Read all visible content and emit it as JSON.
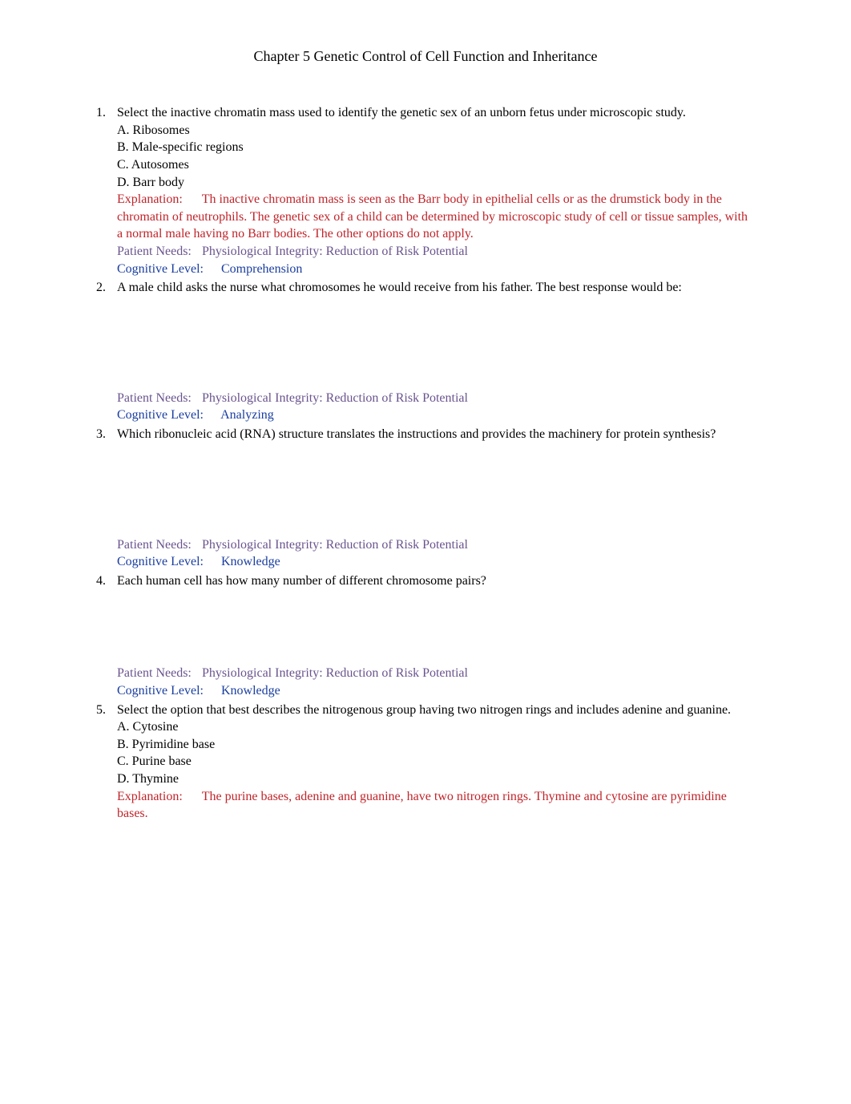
{
  "title": "Chapter 5 Genetic Control of Cell Function and Inheritance",
  "labels": {
    "explanation": "Explanation:",
    "patient_needs": "Patient Needs:",
    "cognitive_level": "Cognitive Level:"
  },
  "questions": [
    {
      "text": "Select the inactive chromatin mass used to identify the genetic sex of an unborn fetus under microscopic study.",
      "options": {
        "a": "A. Ribosomes",
        "b": "B. Male-specific regions",
        "c": "C. Autosomes",
        "d": "D. Barr body"
      },
      "explanation": "Th inactive chromatin mass is seen as the Barr body in epithelial cells or as the drumstick body in the chromatin of neutrophils. The genetic sex of a child can be determined by microscopic study of cell or tissue samples, with a normal male having no Barr bodies. The other options do not apply.",
      "patient_needs": "Physiological Integrity: Reduction of Risk Potential",
      "cognitive_level": "Comprehension"
    },
    {
      "text": "A male child asks the nurse what chromosomes he would receive from his father. The best response would be:",
      "patient_needs": "Physiological Integrity: Reduction of Risk Potential",
      "cognitive_level": "Analyzing"
    },
    {
      "text": "Which ribonucleic acid (RNA) structure translates the instructions and provides the machinery for protein synthesis?",
      "patient_needs": "Physiological Integrity: Reduction of Risk Potential",
      "cognitive_level": "Knowledge"
    },
    {
      "text": "Each human cell has how many number of different chromosome pairs?",
      "patient_needs": "Physiological Integrity: Reduction of Risk Potential",
      "cognitive_level": "Knowledge"
    },
    {
      "text": "Select the option that best describes the nitrogenous group having two nitrogen rings and includes adenine and guanine.",
      "options": {
        "a": "A. Cytosine",
        "b": "B. Pyrimidine base",
        "c": "C. Purine base",
        "d": "D. Thymine"
      },
      "explanation": "The purine bases, adenine and guanine, have two nitrogen rings. Thymine and cytosine are pyrimidine bases."
    }
  ]
}
